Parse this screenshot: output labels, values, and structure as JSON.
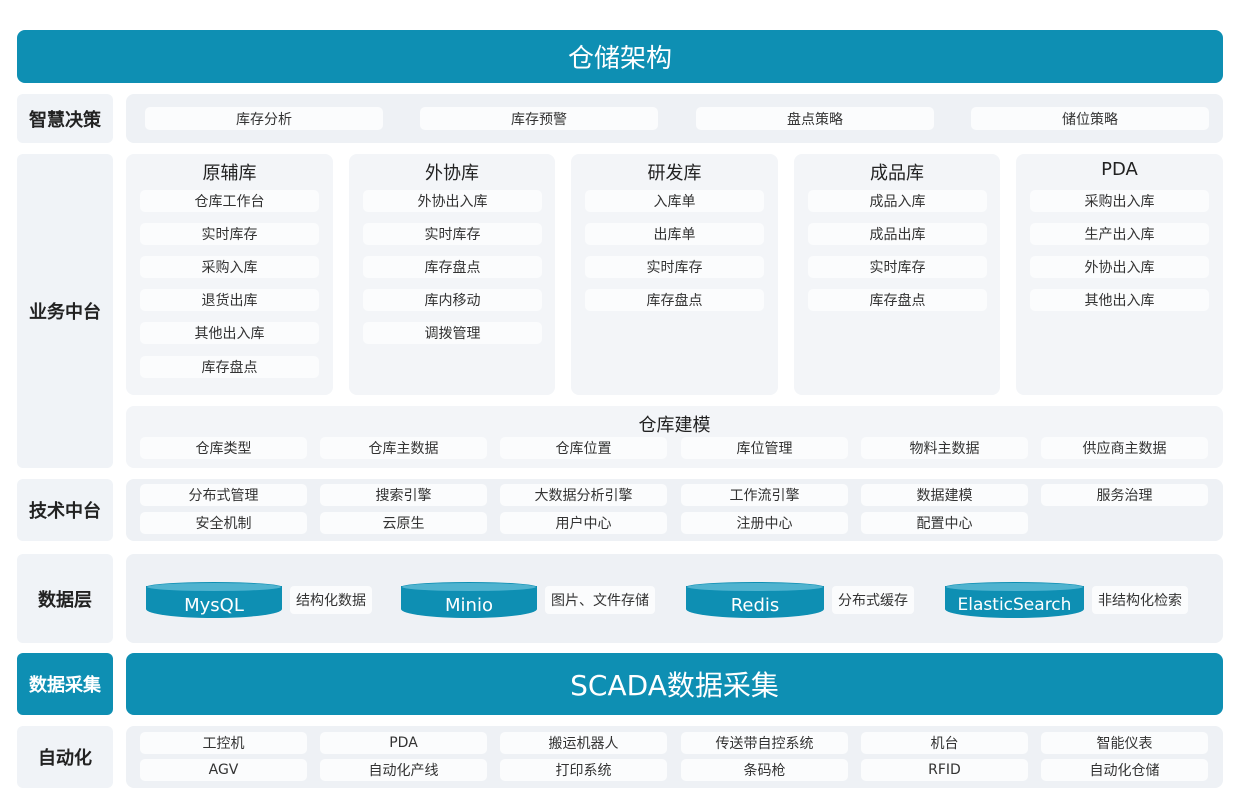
{
  "title": "仓储架构",
  "rows": {
    "decision": {
      "label": "智慧决策",
      "items": [
        "库存分析",
        "库存预警",
        "盘点策略",
        "储位策略"
      ]
    },
    "business": {
      "label": "业务中台",
      "columns": [
        {
          "title": "原辅库",
          "items": [
            "仓库工作台",
            "实时库存",
            "采购入库",
            "退货出库",
            "其他出入库",
            "库存盘点"
          ]
        },
        {
          "title": "外协库",
          "items": [
            "外协出入库",
            "实时库存",
            "库存盘点",
            "库内移动",
            "调拨管理"
          ]
        },
        {
          "title": "研发库",
          "items": [
            "入库单",
            "出库单",
            "实时库存",
            "库存盘点"
          ]
        },
        {
          "title": "成品库",
          "items": [
            "成品入库",
            "成品出库",
            "实时库存",
            "库存盘点"
          ]
        },
        {
          "title": "PDA",
          "items": [
            "采购出入库",
            "生产出入库",
            "外协出入库",
            "其他出入库"
          ]
        }
      ],
      "modeling": {
        "title": "仓库建模",
        "items": [
          "仓库类型",
          "仓库主数据",
          "仓库位置",
          "库位管理",
          "物料主数据",
          "供应商主数据"
        ]
      }
    },
    "tech": {
      "label": "技术中台",
      "row1": [
        "分布式管理",
        "搜索引擎",
        "大数据分析引擎",
        "工作流引擎",
        "数据建模",
        "服务治理"
      ],
      "row2": [
        "安全机制",
        "云原生",
        "用户中心",
        "注册中心",
        "配置中心"
      ]
    },
    "data": {
      "label": "数据层",
      "stores": [
        {
          "name": "MysQL",
          "desc": "结构化数据"
        },
        {
          "name": "Minio",
          "desc": "图片、文件存储"
        },
        {
          "name": "Redis",
          "desc": "分布式缓存"
        },
        {
          "name": "ElasticSearch",
          "desc": "非结构化检索"
        }
      ]
    },
    "collection": {
      "label": "数据采集",
      "banner": "SCADA数据采集"
    },
    "automation": {
      "label": "自动化",
      "row1": [
        "工控机",
        "PDA",
        "搬运机器人",
        "传送带自控系统",
        "机台",
        "智能仪表"
      ],
      "row2": [
        "AGV",
        "自动化产线",
        "打印系统",
        "条码枪",
        "RFID",
        "自动化仓储"
      ]
    }
  },
  "colors": {
    "accent": "#0e8fb3",
    "panel": "#eef1f5",
    "pill": "#fbfcfd"
  }
}
